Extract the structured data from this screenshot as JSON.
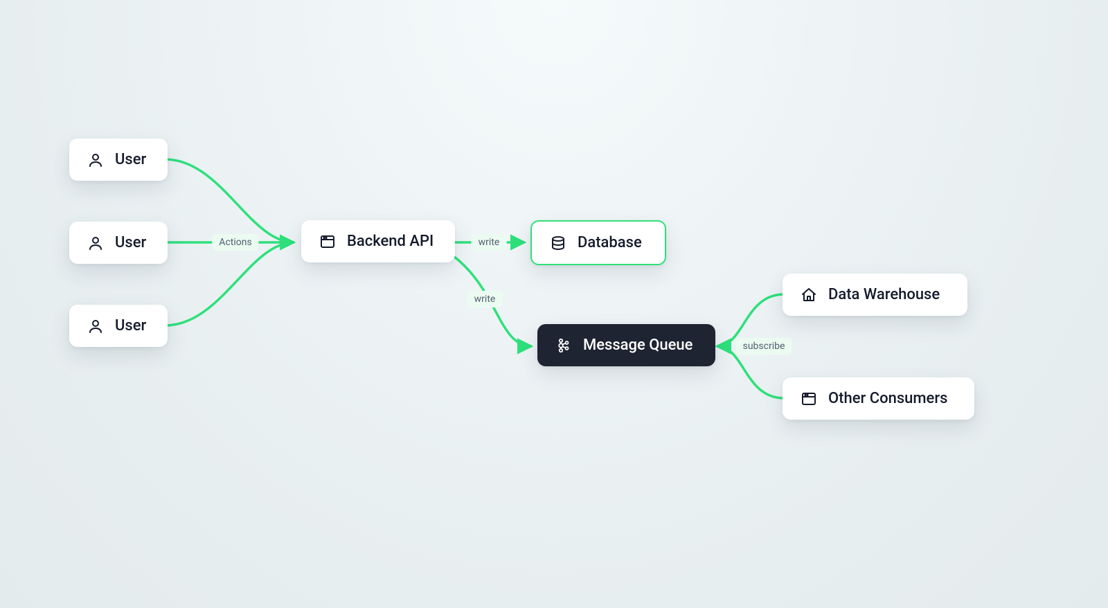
{
  "colors": {
    "edge": "#2ee07b",
    "edge_label_bg": "#ecfbf2",
    "node_bg": "#ffffff",
    "node_dark_bg": "#1f2433",
    "text_dark": "#141a2b",
    "text_light": "#ffffff"
  },
  "nodes": {
    "user1": {
      "label": "User",
      "icon": "user"
    },
    "user2": {
      "label": "User",
      "icon": "user"
    },
    "user3": {
      "label": "User",
      "icon": "user"
    },
    "backend": {
      "label": "Backend API",
      "icon": "window"
    },
    "db": {
      "label": "Database",
      "icon": "database"
    },
    "mq": {
      "label": "Message Queue",
      "icon": "kafka"
    },
    "dw": {
      "label": "Data Warehouse",
      "icon": "home"
    },
    "oc": {
      "label": "Other Consumers",
      "icon": "window"
    }
  },
  "edges": {
    "users_to_backend": {
      "label": "Actions"
    },
    "backend_to_db": {
      "label": "write"
    },
    "backend_to_mq": {
      "label": "write"
    },
    "consumers_to_mq": {
      "label": "subscribe"
    }
  }
}
